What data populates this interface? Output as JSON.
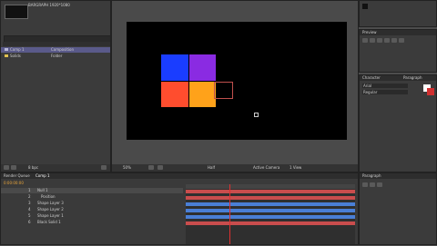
{
  "project": {
    "comp_name": "BARGRAPH 1920*1080",
    "items": [
      {
        "label": "Comp 1",
        "type": "Composition"
      },
      {
        "label": "Solids",
        "type": "Folder"
      }
    ],
    "bpc": "8 bpc"
  },
  "viewer": {
    "zoom": "50%",
    "resolution": "Half",
    "camera": "Active Camera",
    "view": "1 View"
  },
  "right": {
    "preview_title": "Preview",
    "char_title": "Character",
    "paragraph_title": "Paragraph",
    "font": "Arial",
    "style": "Regular",
    "align_title": "Paragraph"
  },
  "timeline": {
    "tab1": "Render Queue",
    "tab2": "Comp 1",
    "timecode": "0:00:00:00",
    "layers": [
      {
        "num": "1",
        "name": "Null 1"
      },
      {
        "num": "2",
        "name": "Position"
      },
      {
        "num": "3",
        "name": "Shape Layer 3"
      },
      {
        "num": "4",
        "name": "Shape Layer 2"
      },
      {
        "num": "5",
        "name": "Shape Layer 1"
      },
      {
        "num": "6",
        "name": "Black Solid 1"
      }
    ],
    "parent_none": "None"
  },
  "colors": {
    "blue": "#1a3dff",
    "purple": "#8a2be2",
    "orange_red": "#ff4d2e",
    "orange": "#ffa21a",
    "timeline_red": "#c94d4d",
    "timeline_blue": "#4a7fd6"
  }
}
